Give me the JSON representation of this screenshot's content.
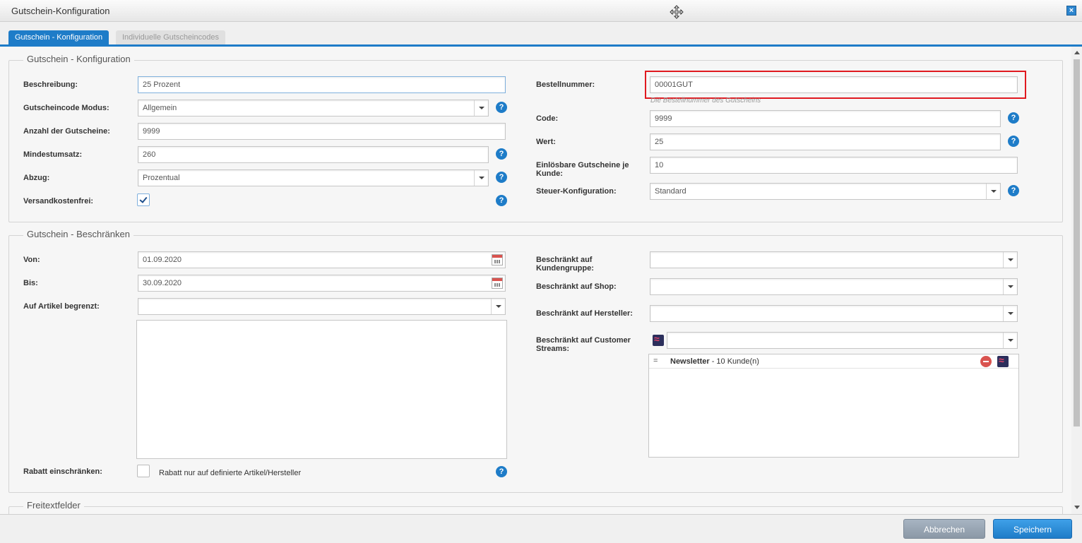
{
  "window": {
    "title": "Gutschein-Konfiguration",
    "close_glyph": "×"
  },
  "tabs": [
    {
      "label": "Gutschein - Konfiguration",
      "active": true
    },
    {
      "label": "Individuelle Gutscheincodes",
      "active": false
    }
  ],
  "config": {
    "legend": "Gutschein - Konfiguration",
    "beschreibung": {
      "label": "Beschreibung:",
      "value": "25 Prozent"
    },
    "modus": {
      "label": "Gutscheincode Modus:",
      "value": "Allgemein"
    },
    "anzahl": {
      "label": "Anzahl der Gutscheine:",
      "value": "9999"
    },
    "mindestumsatz": {
      "label": "Mindestumsatz:",
      "value": "260"
    },
    "abzug": {
      "label": "Abzug:",
      "value": "Prozentual"
    },
    "versandkostenfrei": {
      "label": "Versandkostenfrei:",
      "checked": true
    },
    "bestellnummer": {
      "label": "Bestellnummer:",
      "value": "00001GUT",
      "hint": "Die Bestellnummer des Gutscheins"
    },
    "code": {
      "label": "Code:",
      "value": "9999"
    },
    "wert": {
      "label": "Wert:",
      "value": "25"
    },
    "einloesbar": {
      "label_line1": "Einlösbare Gutscheine je",
      "label_line2": "Kunde:",
      "value": "10"
    },
    "steuer": {
      "label": "Steuer-Konfiguration:",
      "value": "Standard"
    }
  },
  "restrict": {
    "legend": "Gutschein - Beschränken",
    "von": {
      "label": "Von:",
      "value": "01.09.2020"
    },
    "bis": {
      "label": "Bis:",
      "value": "30.09.2020"
    },
    "artikel": {
      "label": "Auf Artikel begrenzt:",
      "value": ""
    },
    "rabatt": {
      "label": "Rabatt einschränken:",
      "checkbox_text": "Rabatt nur auf definierte Artikel/Hersteller",
      "checked": false
    },
    "kundengruppe": {
      "label_line1": "Beschränkt auf",
      "label_line2": "Kundengruppe:",
      "value": ""
    },
    "shop": {
      "label": "Beschränkt auf Shop:",
      "value": ""
    },
    "hersteller": {
      "label": "Beschränkt auf Hersteller:",
      "value": ""
    },
    "streams": {
      "label_line1": "Beschränkt auf Customer",
      "label_line2": "Streams:",
      "value": "",
      "items": [
        {
          "drag": "=",
          "name": "Newsletter",
          "count": " - 10 Kunde(n)"
        }
      ]
    }
  },
  "freitext": {
    "legend": "Freitextfelder"
  },
  "help_glyph": "?",
  "footer": {
    "cancel": "Abbrechen",
    "save": "Speichern"
  },
  "colors": {
    "accent": "#1e7cc8",
    "highlight": "#e0191f",
    "remove": "#d9534f"
  }
}
